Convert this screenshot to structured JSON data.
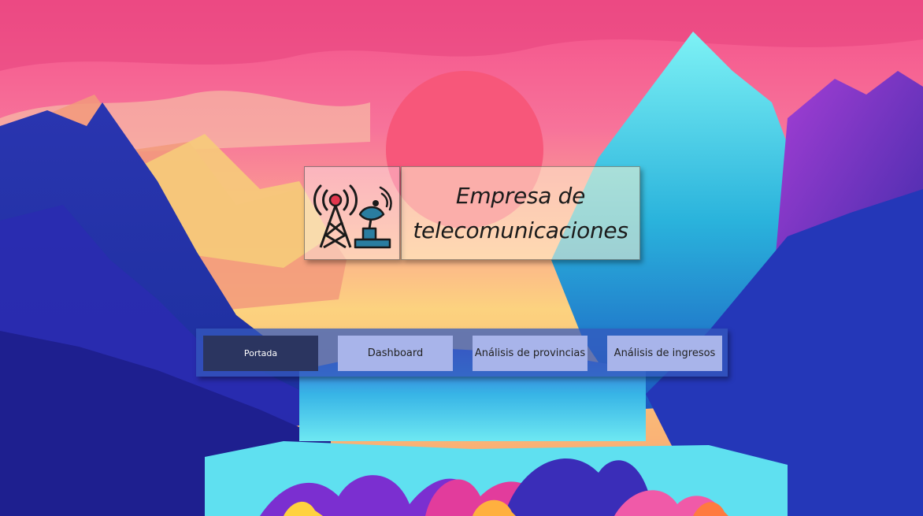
{
  "header": {
    "title_line1": "Empresa de",
    "title_line2": "telecomunicaciones",
    "logo_icon": "telecom-tower-satellite-icon"
  },
  "nav": {
    "items": [
      {
        "label": "Portada",
        "active": true
      },
      {
        "label": "Dashboard",
        "active": false
      },
      {
        "label": "Análisis de provincias",
        "active": false
      },
      {
        "label": "Análisis de ingresos",
        "active": false
      }
    ]
  },
  "colors": {
    "nav_active": "#2b3560",
    "nav_inactive": "#a8b4ea",
    "icon_accent": "#e2374e",
    "icon_dish": "#2a7da0"
  }
}
